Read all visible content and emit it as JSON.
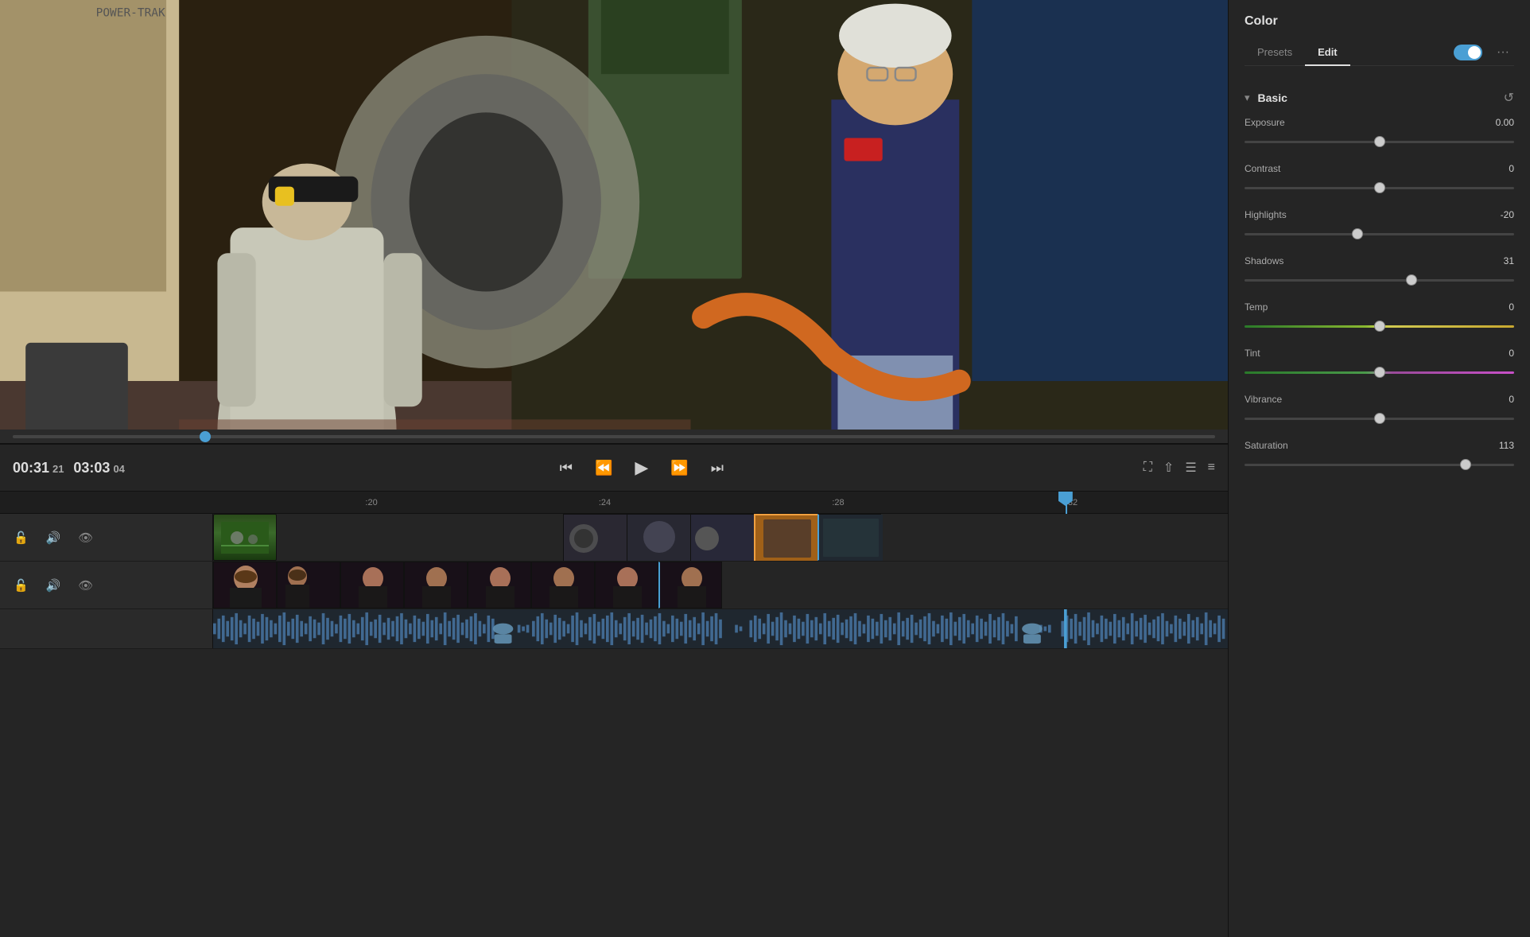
{
  "panel": {
    "title": "Color",
    "tabs": [
      {
        "id": "presets",
        "label": "Presets",
        "active": false
      },
      {
        "id": "edit",
        "label": "Edit",
        "active": true
      }
    ],
    "toggle_state": true,
    "more_icon": "•••"
  },
  "color_section": {
    "title": "Basic",
    "sliders": [
      {
        "id": "exposure",
        "label": "Exposure",
        "value": "0.00",
        "percent": 50
      },
      {
        "id": "contrast",
        "label": "Contrast",
        "value": "0",
        "percent": 50
      },
      {
        "id": "highlights",
        "label": "Highlights",
        "value": "-20",
        "percent": 42
      },
      {
        "id": "shadows",
        "label": "Shadows",
        "value": "31",
        "percent": 62
      },
      {
        "id": "temp",
        "label": "Temp",
        "value": "0",
        "percent": 50,
        "special": "temp"
      },
      {
        "id": "tint",
        "label": "Tint",
        "value": "0",
        "percent": 50,
        "special": "tint"
      },
      {
        "id": "vibrance",
        "label": "Vibrance",
        "value": "0",
        "percent": 50
      },
      {
        "id": "saturation",
        "label": "Saturation",
        "value": "113",
        "percent": 82
      }
    ]
  },
  "transport": {
    "timecode": "00:31",
    "timecode_frames": "21",
    "duration": "03:03",
    "duration_frames": "04"
  },
  "timeline": {
    "ruler_marks": [
      ":20",
      ":24",
      ":28",
      ":32"
    ],
    "ruler_positions": [
      "15%",
      "38%",
      "61%",
      "84%"
    ]
  },
  "icons": {
    "skip_back": "⏮",
    "step_back": "⏪",
    "play": "▶",
    "step_forward": "⏩",
    "skip_forward": "⏭",
    "fullscreen": "⛶",
    "export": "⇧",
    "settings": "☰",
    "lock": "🔓",
    "audio": "🔊",
    "eye": "👁",
    "chevron_down": "▾",
    "reset": "↺",
    "more": "···"
  }
}
